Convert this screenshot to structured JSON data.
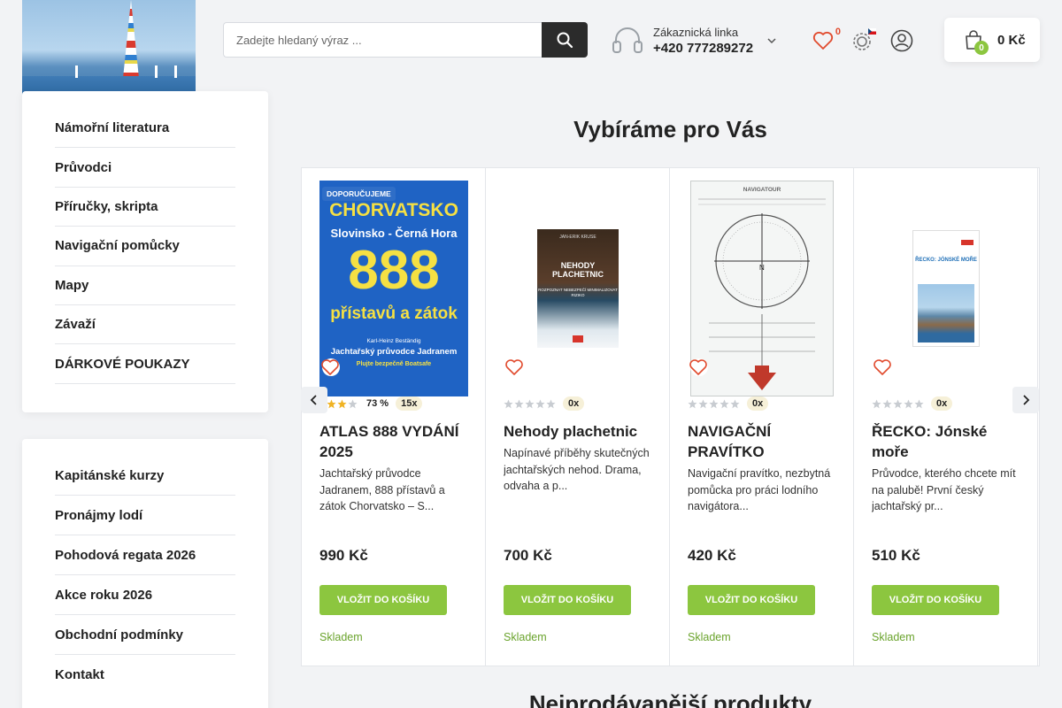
{
  "header": {
    "search_placeholder": "Zadejte hledaný výraz ...",
    "support_label": "Zákaznická linka",
    "support_phone": "+420 777289272",
    "wishlist_count": "0",
    "cart_count": "0",
    "cart_total": "0 Kč"
  },
  "sidebar": {
    "categories": [
      {
        "label": "Námořní literatura"
      },
      {
        "label": "Průvodci"
      },
      {
        "label": "Příručky, skripta"
      },
      {
        "label": "Navigační pomůcky"
      },
      {
        "label": "Mapy"
      },
      {
        "label": "Závaží"
      },
      {
        "label": "DÁRKOVÉ POUKAZY"
      }
    ],
    "links": [
      {
        "label": "Kapitánské kurzy"
      },
      {
        "label": "Pronájmy lodí"
      },
      {
        "label": "Pohodová regata 2026"
      },
      {
        "label": "Akce roku 2026"
      },
      {
        "label": "Obchodní podmínky"
      },
      {
        "label": "Kontakt"
      }
    ]
  },
  "main": {
    "section_title": "Vybíráme pro Vás",
    "next_section_title": "Nejprodávanější produkty"
  },
  "products": [
    {
      "badge": "DOPORUČUJEME",
      "name": "ATLAS 888 VYDÁNÍ 2025",
      "description": "Jachtařský průvodce Jadranem, 888 přístavů a zátok Chorvatsko – S...",
      "rating_stars": 4,
      "rating_pct": "73 %",
      "review_count": "15x",
      "price": "990 Kč",
      "buy_label": "VLOŽIT DO KOŠÍKU",
      "stock": "Skladem",
      "cover": {
        "line1": "CHORVATSKO",
        "line2": "Slovinsko - Černá Hora",
        "line3": "888",
        "line4": "přístavů a zátok",
        "line5": "Karl-Heinz Beständig",
        "line6": "Jachtařský průvodce Jadranem",
        "line7": "Plujte bezpečně Boatsafe"
      }
    },
    {
      "name": "Nehody plachetnic",
      "description": "Napínavé příběhy skutečných jachtařských nehod. Drama, odvaha a p...",
      "rating_stars": 0,
      "rating_pct": "",
      "review_count": "0x",
      "price": "700 Kč",
      "buy_label": "VLOŽIT DO KOŠÍKU",
      "stock": "Skladem",
      "cover": {
        "author": "JAN-ERIK KRUSE",
        "title": "NEHODY PLACHETNIC",
        "subtitle": "ROZPOZNAT NEBEZPEČÍ MINIMALIZOVAT RIZIKO"
      }
    },
    {
      "name": "NAVIGAČNÍ PRAVÍTKO",
      "description": "Navigační pravítko, nezbytná pomůcka pro práci lodního navigátora...",
      "rating_stars": 0,
      "rating_pct": "",
      "review_count": "0x",
      "price": "420 Kč",
      "buy_label": "VLOŽIT DO KOŠÍKU",
      "stock": "Skladem",
      "cover": {
        "brand": "NAVIGATOUR"
      }
    },
    {
      "name": "ŘECKO: Jónské moře",
      "description": "Průvodce, kterého chcete mít na palubě! První český jachtařský pr...",
      "rating_stars": 0,
      "rating_pct": "",
      "review_count": "0x",
      "price": "510 Kč",
      "buy_label": "VLOŽIT DO KOŠÍKU",
      "stock": "Skladem",
      "cover": {
        "title": "ŘECKO: JÓNSKÉ MOŘE"
      }
    }
  ],
  "colors": {
    "accent_green": "#8cc63f",
    "stock_green": "#6aa32c",
    "badge_blue": "#2f6ec7",
    "wishlist_red": "#e14b2e"
  }
}
